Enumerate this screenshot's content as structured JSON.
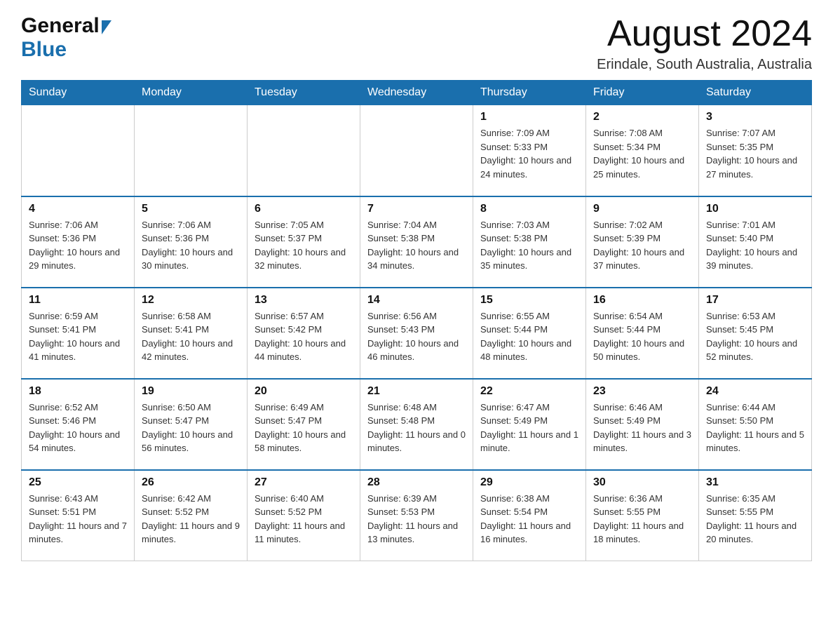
{
  "header": {
    "logo_general": "General",
    "logo_blue": "Blue",
    "month_title": "August 2024",
    "location": "Erindale, South Australia, Australia"
  },
  "calendar": {
    "days_of_week": [
      "Sunday",
      "Monday",
      "Tuesday",
      "Wednesday",
      "Thursday",
      "Friday",
      "Saturday"
    ],
    "weeks": [
      [
        {
          "day": "",
          "info": ""
        },
        {
          "day": "",
          "info": ""
        },
        {
          "day": "",
          "info": ""
        },
        {
          "day": "",
          "info": ""
        },
        {
          "day": "1",
          "info": "Sunrise: 7:09 AM\nSunset: 5:33 PM\nDaylight: 10 hours and 24 minutes."
        },
        {
          "day": "2",
          "info": "Sunrise: 7:08 AM\nSunset: 5:34 PM\nDaylight: 10 hours and 25 minutes."
        },
        {
          "day": "3",
          "info": "Sunrise: 7:07 AM\nSunset: 5:35 PM\nDaylight: 10 hours and 27 minutes."
        }
      ],
      [
        {
          "day": "4",
          "info": "Sunrise: 7:06 AM\nSunset: 5:36 PM\nDaylight: 10 hours and 29 minutes."
        },
        {
          "day": "5",
          "info": "Sunrise: 7:06 AM\nSunset: 5:36 PM\nDaylight: 10 hours and 30 minutes."
        },
        {
          "day": "6",
          "info": "Sunrise: 7:05 AM\nSunset: 5:37 PM\nDaylight: 10 hours and 32 minutes."
        },
        {
          "day": "7",
          "info": "Sunrise: 7:04 AM\nSunset: 5:38 PM\nDaylight: 10 hours and 34 minutes."
        },
        {
          "day": "8",
          "info": "Sunrise: 7:03 AM\nSunset: 5:38 PM\nDaylight: 10 hours and 35 minutes."
        },
        {
          "day": "9",
          "info": "Sunrise: 7:02 AM\nSunset: 5:39 PM\nDaylight: 10 hours and 37 minutes."
        },
        {
          "day": "10",
          "info": "Sunrise: 7:01 AM\nSunset: 5:40 PM\nDaylight: 10 hours and 39 minutes."
        }
      ],
      [
        {
          "day": "11",
          "info": "Sunrise: 6:59 AM\nSunset: 5:41 PM\nDaylight: 10 hours and 41 minutes."
        },
        {
          "day": "12",
          "info": "Sunrise: 6:58 AM\nSunset: 5:41 PM\nDaylight: 10 hours and 42 minutes."
        },
        {
          "day": "13",
          "info": "Sunrise: 6:57 AM\nSunset: 5:42 PM\nDaylight: 10 hours and 44 minutes."
        },
        {
          "day": "14",
          "info": "Sunrise: 6:56 AM\nSunset: 5:43 PM\nDaylight: 10 hours and 46 minutes."
        },
        {
          "day": "15",
          "info": "Sunrise: 6:55 AM\nSunset: 5:44 PM\nDaylight: 10 hours and 48 minutes."
        },
        {
          "day": "16",
          "info": "Sunrise: 6:54 AM\nSunset: 5:44 PM\nDaylight: 10 hours and 50 minutes."
        },
        {
          "day": "17",
          "info": "Sunrise: 6:53 AM\nSunset: 5:45 PM\nDaylight: 10 hours and 52 minutes."
        }
      ],
      [
        {
          "day": "18",
          "info": "Sunrise: 6:52 AM\nSunset: 5:46 PM\nDaylight: 10 hours and 54 minutes."
        },
        {
          "day": "19",
          "info": "Sunrise: 6:50 AM\nSunset: 5:47 PM\nDaylight: 10 hours and 56 minutes."
        },
        {
          "day": "20",
          "info": "Sunrise: 6:49 AM\nSunset: 5:47 PM\nDaylight: 10 hours and 58 minutes."
        },
        {
          "day": "21",
          "info": "Sunrise: 6:48 AM\nSunset: 5:48 PM\nDaylight: 11 hours and 0 minutes."
        },
        {
          "day": "22",
          "info": "Sunrise: 6:47 AM\nSunset: 5:49 PM\nDaylight: 11 hours and 1 minute."
        },
        {
          "day": "23",
          "info": "Sunrise: 6:46 AM\nSunset: 5:49 PM\nDaylight: 11 hours and 3 minutes."
        },
        {
          "day": "24",
          "info": "Sunrise: 6:44 AM\nSunset: 5:50 PM\nDaylight: 11 hours and 5 minutes."
        }
      ],
      [
        {
          "day": "25",
          "info": "Sunrise: 6:43 AM\nSunset: 5:51 PM\nDaylight: 11 hours and 7 minutes."
        },
        {
          "day": "26",
          "info": "Sunrise: 6:42 AM\nSunset: 5:52 PM\nDaylight: 11 hours and 9 minutes."
        },
        {
          "day": "27",
          "info": "Sunrise: 6:40 AM\nSunset: 5:52 PM\nDaylight: 11 hours and 11 minutes."
        },
        {
          "day": "28",
          "info": "Sunrise: 6:39 AM\nSunset: 5:53 PM\nDaylight: 11 hours and 13 minutes."
        },
        {
          "day": "29",
          "info": "Sunrise: 6:38 AM\nSunset: 5:54 PM\nDaylight: 11 hours and 16 minutes."
        },
        {
          "day": "30",
          "info": "Sunrise: 6:36 AM\nSunset: 5:55 PM\nDaylight: 11 hours and 18 minutes."
        },
        {
          "day": "31",
          "info": "Sunrise: 6:35 AM\nSunset: 5:55 PM\nDaylight: 11 hours and 20 minutes."
        }
      ]
    ]
  }
}
